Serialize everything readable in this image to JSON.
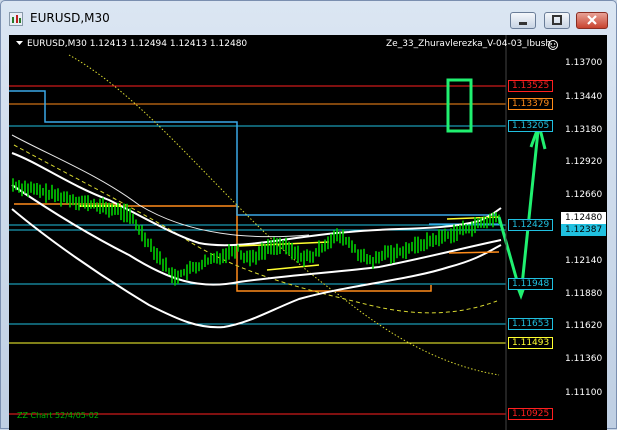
{
  "window": {
    "title": "EURUSD,M30"
  },
  "chart": {
    "symbol_header": "EURUSD,M30  1.12413 1.12494 1.12413 1.12480",
    "indicator_name": "Ze_33_Zhuravlerezka_V-04-03_Ibush",
    "footer_text": "ZZ Chart 52/4/05-02",
    "y_axis_ticks": [
      "1.13700",
      "1.13440",
      "1.13180",
      "1.12920",
      "1.12660",
      "1.12140",
      "1.11880",
      "1.11620",
      "1.11360",
      "1.11100"
    ],
    "price_labels": [
      {
        "value": "1.13525",
        "color": "#ff2020",
        "text_color": "#ff2020",
        "bg": "#000000"
      },
      {
        "value": "1.13379",
        "color": "#ff8c1a",
        "text_color": "#ff8c1a",
        "bg": "#000000"
      },
      {
        "value": "1.13205",
        "color": "#20c0e0",
        "text_color": "#20c0e0",
        "bg": "#000000"
      },
      {
        "value": "1.12480",
        "color": "#ffffff",
        "text_color": "#000000",
        "bg": "#ffffff"
      },
      {
        "value": "1.12429",
        "color": "#20c0e0",
        "text_color": "#20c0e0",
        "bg": "#000000"
      },
      {
        "value": "1.12387",
        "color": "#20c0e0",
        "text_color": "#000000",
        "bg": "#20c0e0"
      },
      {
        "value": "1.11948",
        "color": "#20c0e0",
        "text_color": "#20c0e0",
        "bg": "#000000"
      },
      {
        "value": "1.11653",
        "color": "#20c0e0",
        "text_color": "#20c0e0",
        "bg": "#000000"
      },
      {
        "value": "1.11493",
        "color": "#ffff30",
        "text_color": "#ffff30",
        "bg": "#000000"
      },
      {
        "value": "1.10925",
        "color": "#ff2020",
        "text_color": "#ff2020",
        "bg": "#000000"
      }
    ],
    "colors": {
      "background": "#000000",
      "candles": "#00d000",
      "bands": "#ffffff",
      "ma_dotted": "#d8d830",
      "steps": "#3aa8e8",
      "range_box": "#ff8c1a",
      "arrow": "#20f070",
      "highlight_box": "#20f070"
    }
  }
}
